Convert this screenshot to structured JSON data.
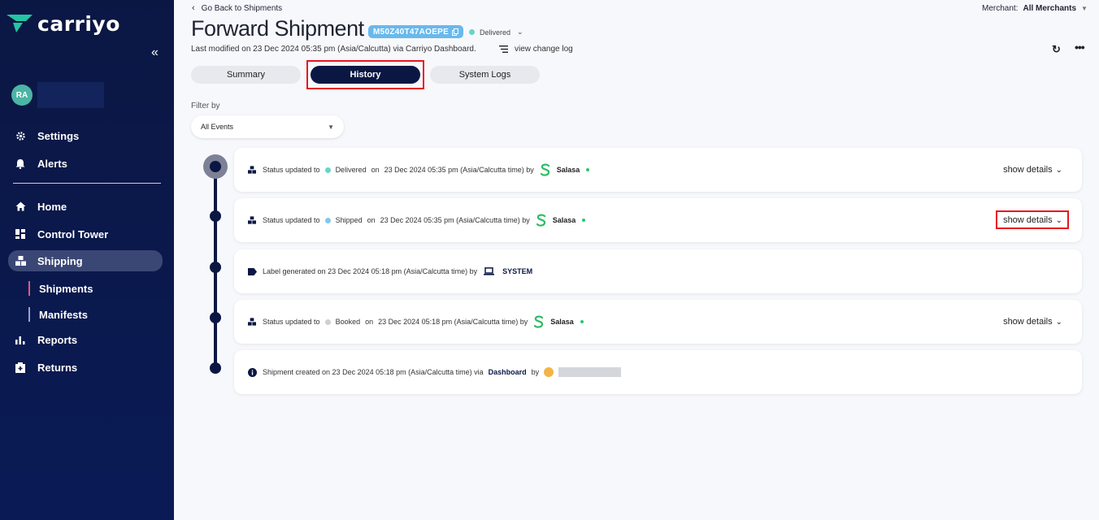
{
  "brand": {
    "name": "carriyo"
  },
  "user": {
    "initials": "RA"
  },
  "sidebar": {
    "items": [
      {
        "label": "Settings",
        "icon": "gear-icon"
      },
      {
        "label": "Alerts",
        "icon": "bell-icon"
      },
      {
        "label": "Home",
        "icon": "home-icon"
      },
      {
        "label": "Control Tower",
        "icon": "dashboard-icon"
      },
      {
        "label": "Shipping",
        "icon": "boxes-icon"
      },
      {
        "label": "Reports",
        "icon": "bar-chart-icon"
      },
      {
        "label": "Returns",
        "icon": "return-box-icon"
      }
    ],
    "sub_items": [
      {
        "label": "Shipments"
      },
      {
        "label": "Manifests"
      }
    ]
  },
  "header": {
    "back_label": "Go Back to Shipments",
    "merchant_label": "Merchant:",
    "merchant_value": "All Merchants",
    "title": "Forward Shipment",
    "awb": "M50Z40T47AOEPE",
    "status": "Delivered",
    "modified": "Last modified on 23 Dec 2024 05:35 pm (Asia/Calcutta) via Carriyo Dashboard.",
    "changelog": "view change log"
  },
  "tabs": [
    {
      "label": "Summary"
    },
    {
      "label": "History"
    },
    {
      "label": "System Logs"
    }
  ],
  "filter": {
    "label": "Filter by",
    "value": "All Events"
  },
  "colors": {
    "delivered": "#64d6c7",
    "shipped": "#7fc8f0",
    "booked": "#cfcfcf",
    "accent": "#0b1743"
  },
  "events": [
    {
      "prefix": "Status updated to",
      "status": "Delivered",
      "on": "on",
      "when": "23 Dec 2024 05:35 pm (Asia/Calcutta time) by",
      "carrier": "Salasa",
      "details": "show details"
    },
    {
      "prefix": "Status updated to",
      "status": "Shipped",
      "on": "on",
      "when": "23 Dec 2024 05:35 pm (Asia/Calcutta time) by",
      "carrier": "Salasa",
      "details": "show details"
    },
    {
      "text": "Label generated on 23 Dec 2024 05:18 pm (Asia/Calcutta time) by",
      "actor": "SYSTEM"
    },
    {
      "prefix": "Status updated to",
      "status": "Booked",
      "on": "on",
      "when": "23 Dec 2024 05:18 pm (Asia/Calcutta time) by",
      "carrier": "Salasa",
      "details": "show details"
    },
    {
      "text": "Shipment created on 23 Dec 2024 05:18 pm (Asia/Calcutta time) via",
      "via": "Dashboard",
      "by": "by"
    }
  ]
}
